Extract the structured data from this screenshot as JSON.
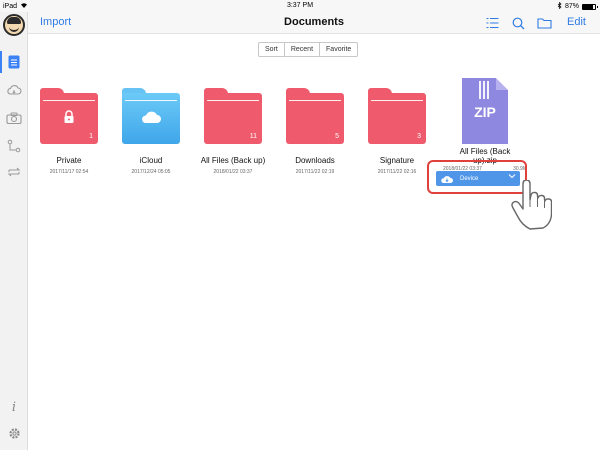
{
  "status": {
    "device": "iPad",
    "time": "3:37 PM",
    "battery": "87%"
  },
  "nav": {
    "import_label": "Import",
    "title": "Documents",
    "edit_label": "Edit"
  },
  "sort_tabs": [
    "Sort",
    "Recent",
    "Favorite"
  ],
  "files": [
    {
      "name": "Private",
      "date": "2017/11/17 02:54",
      "count": "1",
      "color": "#ef5b6c",
      "icon": "lock-icon"
    },
    {
      "name": "iCloud",
      "date": "2017/12/24 05:05",
      "count": "",
      "color": "#4fb4f0",
      "icon": "cloud-icon"
    },
    {
      "name": "All Files (Back up)",
      "date": "2018/01/22 03:37",
      "count": "11",
      "color": "#ef5b6c"
    },
    {
      "name": "Downloads",
      "date": "2017/11/22 02:19",
      "count": "5",
      "color": "#ef5b6c"
    },
    {
      "name": "Signature",
      "date": "2017/11/22 02:16",
      "count": "3",
      "color": "#ef5b6c"
    }
  ],
  "zip_file": {
    "badge": "ZIP",
    "name": "All Files (Back up).zip",
    "date": "2018/01/22 03:37",
    "size": "30.9M"
  },
  "device_button": {
    "label": "Device"
  },
  "sidebar": {
    "info_label": "i"
  }
}
